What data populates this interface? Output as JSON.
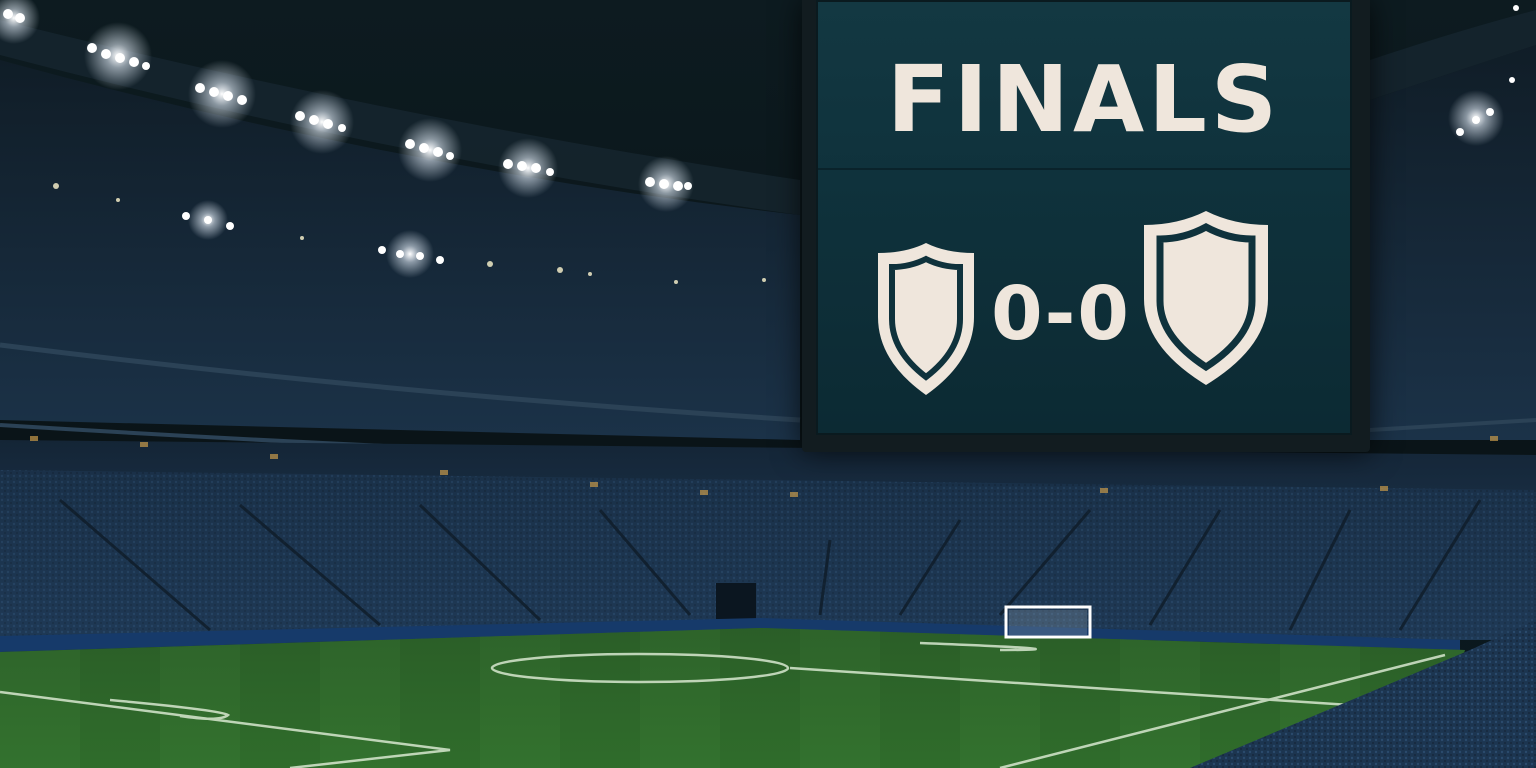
{
  "scoreboard": {
    "title": "FINALS",
    "score": "0-0",
    "home_crest_icon": "shield-icon",
    "away_crest_icon": "shield-icon",
    "screen_color": "#0f323c",
    "text_color": "#efe6dc"
  },
  "colors": {
    "sky": "#0b1519",
    "pitch": "#2f6f2c",
    "pitch_stripe": "#3a7f35",
    "stands": "#1a2e44",
    "floodlight": "#ffffff"
  }
}
